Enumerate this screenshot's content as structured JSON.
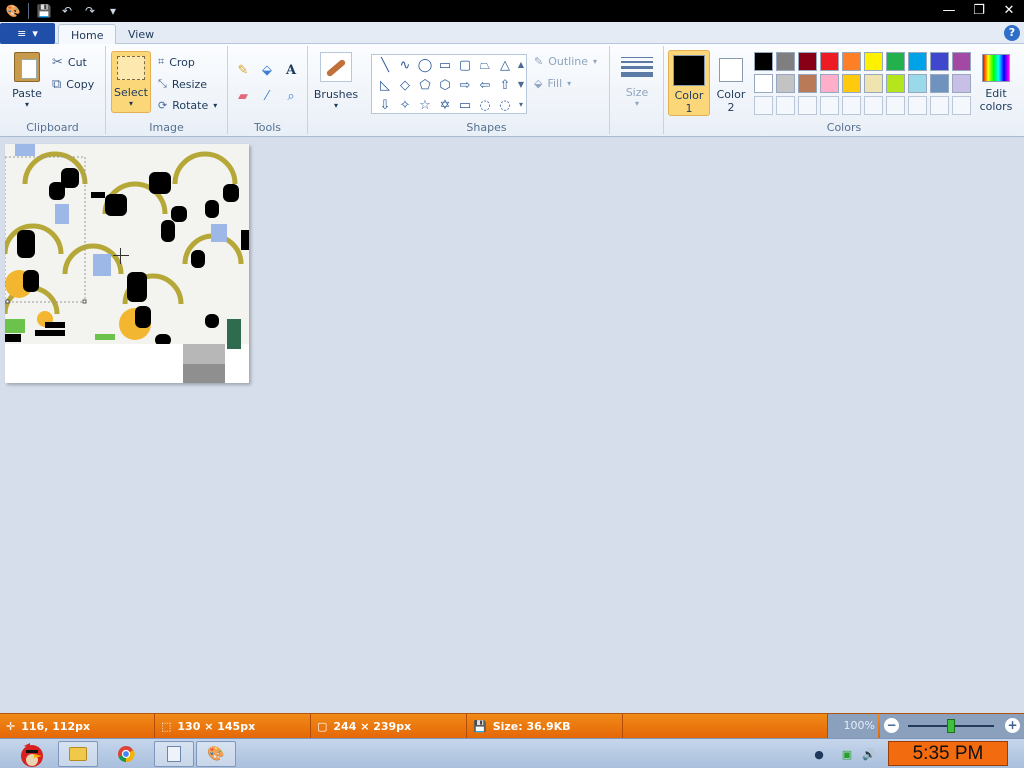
{
  "window": {
    "title": "",
    "minimize": "—",
    "restore": "❐",
    "close": "✕"
  },
  "quick_access": [
    "save-icon",
    "undo-icon",
    "redo-icon",
    "customize-icon"
  ],
  "tabs": {
    "app_menu_icon": "≡",
    "home": "Home",
    "view": "View",
    "help": "?"
  },
  "ribbon": {
    "clipboard": {
      "label": "Clipboard",
      "paste": "Paste",
      "cut": "Cut",
      "copy": "Copy"
    },
    "image": {
      "label": "Image",
      "select": "Select",
      "crop": "Crop",
      "resize": "Resize",
      "rotate": "Rotate"
    },
    "tools": {
      "label": "Tools",
      "items": [
        "pencil-icon",
        "fill-icon",
        "text-icon",
        "eraser-icon",
        "color-picker-icon",
        "magnifier-icon"
      ]
    },
    "brushes": {
      "label": "Brushes"
    },
    "shapes": {
      "label": "Shapes",
      "outline": "Outline",
      "fill": "Fill",
      "items": [
        "╲",
        "∿",
        "◯",
        "▭",
        "▢",
        "⏢",
        "△",
        "◺",
        "◇",
        "⬠",
        "⬡",
        "⇨",
        "⇦",
        "⇧",
        "⇩",
        "✧",
        "☆",
        "✡",
        "▭",
        "◌",
        "◌"
      ]
    },
    "size": {
      "label": "Size"
    },
    "colors": {
      "label": "Colors",
      "color1": "Color",
      "color1_num": "1",
      "color2": "Color",
      "color2_num": "2",
      "edit_colors": "Edit",
      "edit_colors2": "colors",
      "color1_value": "#000000",
      "color2_value": "#ffffff",
      "palette_row1": [
        "#000000",
        "#7f7f7f",
        "#880015",
        "#ed1c24",
        "#ff7f27",
        "#fff200",
        "#22b14c",
        "#00a2e8",
        "#3f48cc",
        "#a349a4"
      ],
      "palette_row2": [
        "#ffffff",
        "#c3c3c3",
        "#b97a57",
        "#ffaec9",
        "#ffc90e",
        "#efe4b0",
        "#b5e61d",
        "#99d9ea",
        "#7092be",
        "#c8bfe7"
      ]
    }
  },
  "status": {
    "cursor_pos": "116, 112px",
    "selection_size": "130 × 145px",
    "image_size": "244 × 239px",
    "file_size": "Size: 36.9KB",
    "zoom": "100%",
    "zoom_out": "−",
    "zoom_in": "+"
  },
  "taskbar": {
    "apps": [
      "start-orb",
      "explorer-icon",
      "chrome-icon",
      "notepad-icon",
      "paint-icon"
    ],
    "clock": "5:35 PM"
  }
}
